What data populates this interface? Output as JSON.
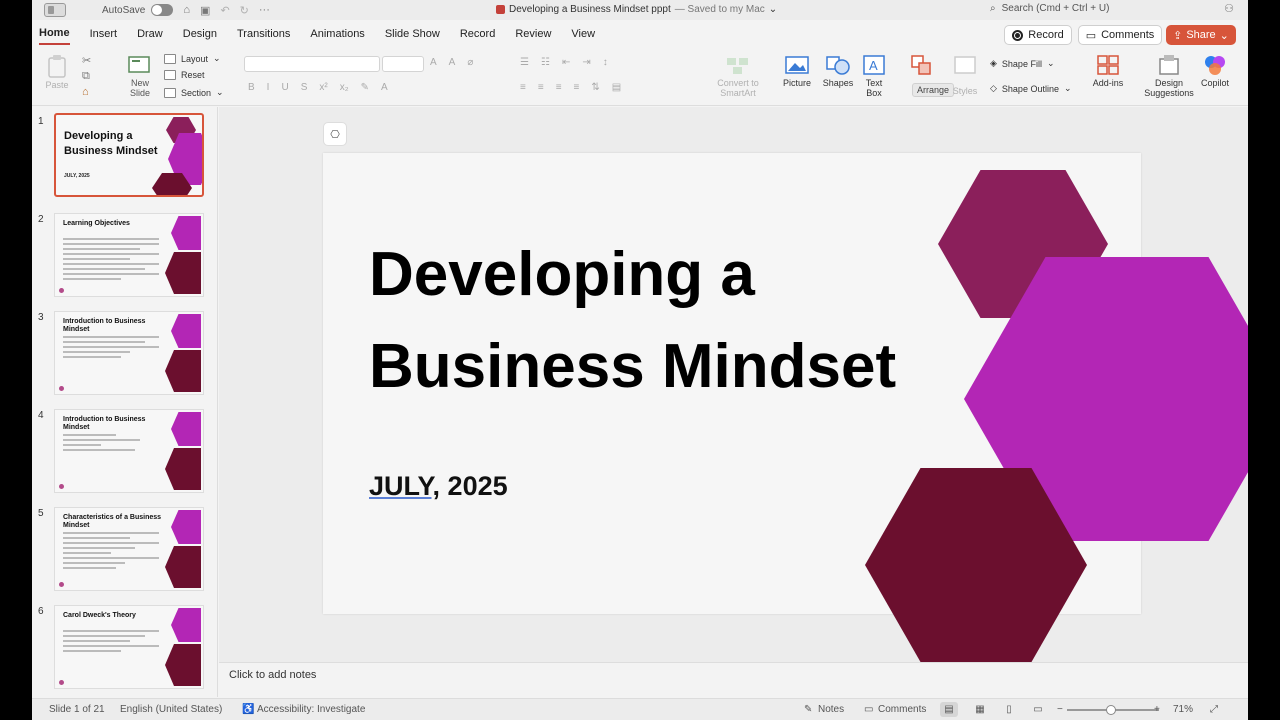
{
  "titlebar": {
    "autosave_label": "AutoSave",
    "doc_name": "Developing a Business Mindset pppt",
    "saved_status": "— Saved to my Mac",
    "search_placeholder": "Search (Cmd + Ctrl + U)"
  },
  "tabs": [
    "Home",
    "Insert",
    "Draw",
    "Design",
    "Transitions",
    "Animations",
    "Slide Show",
    "Record",
    "Review",
    "View"
  ],
  "actions": {
    "record": "Record",
    "comments": "Comments",
    "share": "Share"
  },
  "ribbon": {
    "paste": "Paste",
    "new_slide_1": "New",
    "new_slide_2": "Slide",
    "layout": "Layout",
    "reset": "Reset",
    "section": "Section",
    "convert_1": "Convert to",
    "convert_2": "SmartArt",
    "picture": "Picture",
    "shapes": "Shapes",
    "textbox_1": "Text",
    "textbox_2": "Box",
    "arrange_tooltip": "Arrange",
    "quick_styles": "Styles",
    "shape_fill": "Shape Fill",
    "shape_outline": "Shape Outline",
    "addins": "Add-ins",
    "design_1": "Design",
    "design_2": "Suggestions",
    "copilot": "Copilot"
  },
  "thumbnails": [
    {
      "num": "1",
      "title": "Developing a Business Mindset",
      "date": "JULY, 2025"
    },
    {
      "num": "2",
      "title": "Learning Objectives"
    },
    {
      "num": "3",
      "title": "Introduction to Business Mindset"
    },
    {
      "num": "4",
      "title": "Introduction to Business Mindset"
    },
    {
      "num": "5",
      "title": "Characteristics of a Business Mindset"
    },
    {
      "num": "6",
      "title": "Carol Dweck's Theory"
    }
  ],
  "slide": {
    "title": "Developing a Business Mindset",
    "date_part1": "JULY,",
    "date_part2": " 2025",
    "colors": {
      "hex_top": "#8b1f5b",
      "hex_mid": "#b326b5",
      "hex_bottom": "#6b0f2e"
    }
  },
  "notes_placeholder": "Click to add notes",
  "statusbar": {
    "slide_info": "Slide 1 of 21",
    "language": "English (United States)",
    "accessibility": "Accessibility: Investigate",
    "notes": "Notes",
    "comments": "Comments",
    "zoom": "71%"
  }
}
